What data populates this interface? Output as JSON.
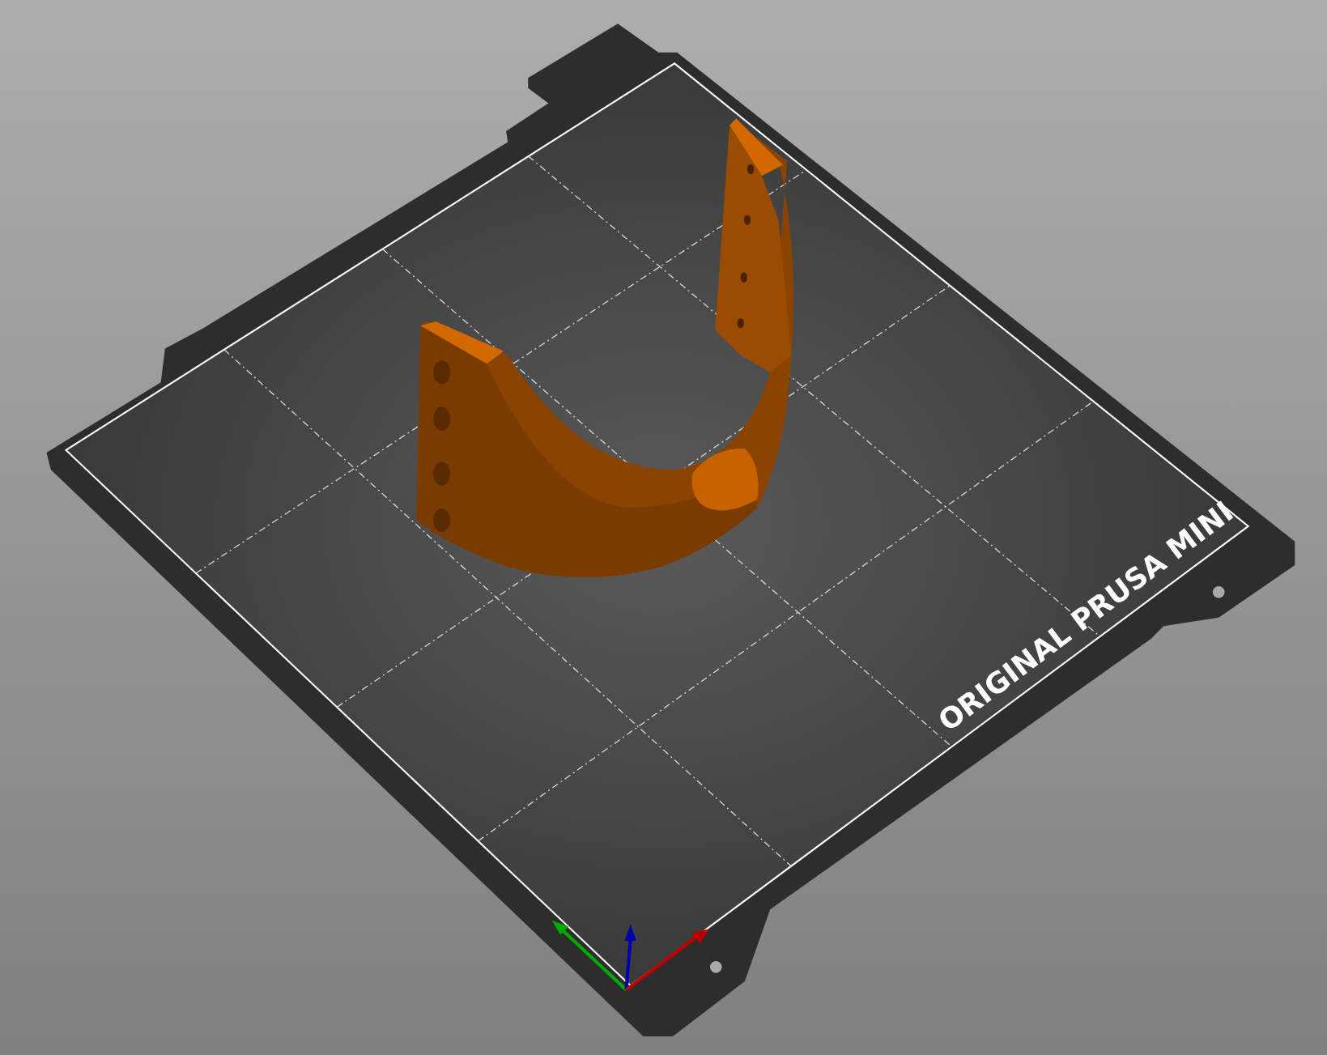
{
  "bed": {
    "label": "ORIGINAL PRUSA MINI"
  }
}
